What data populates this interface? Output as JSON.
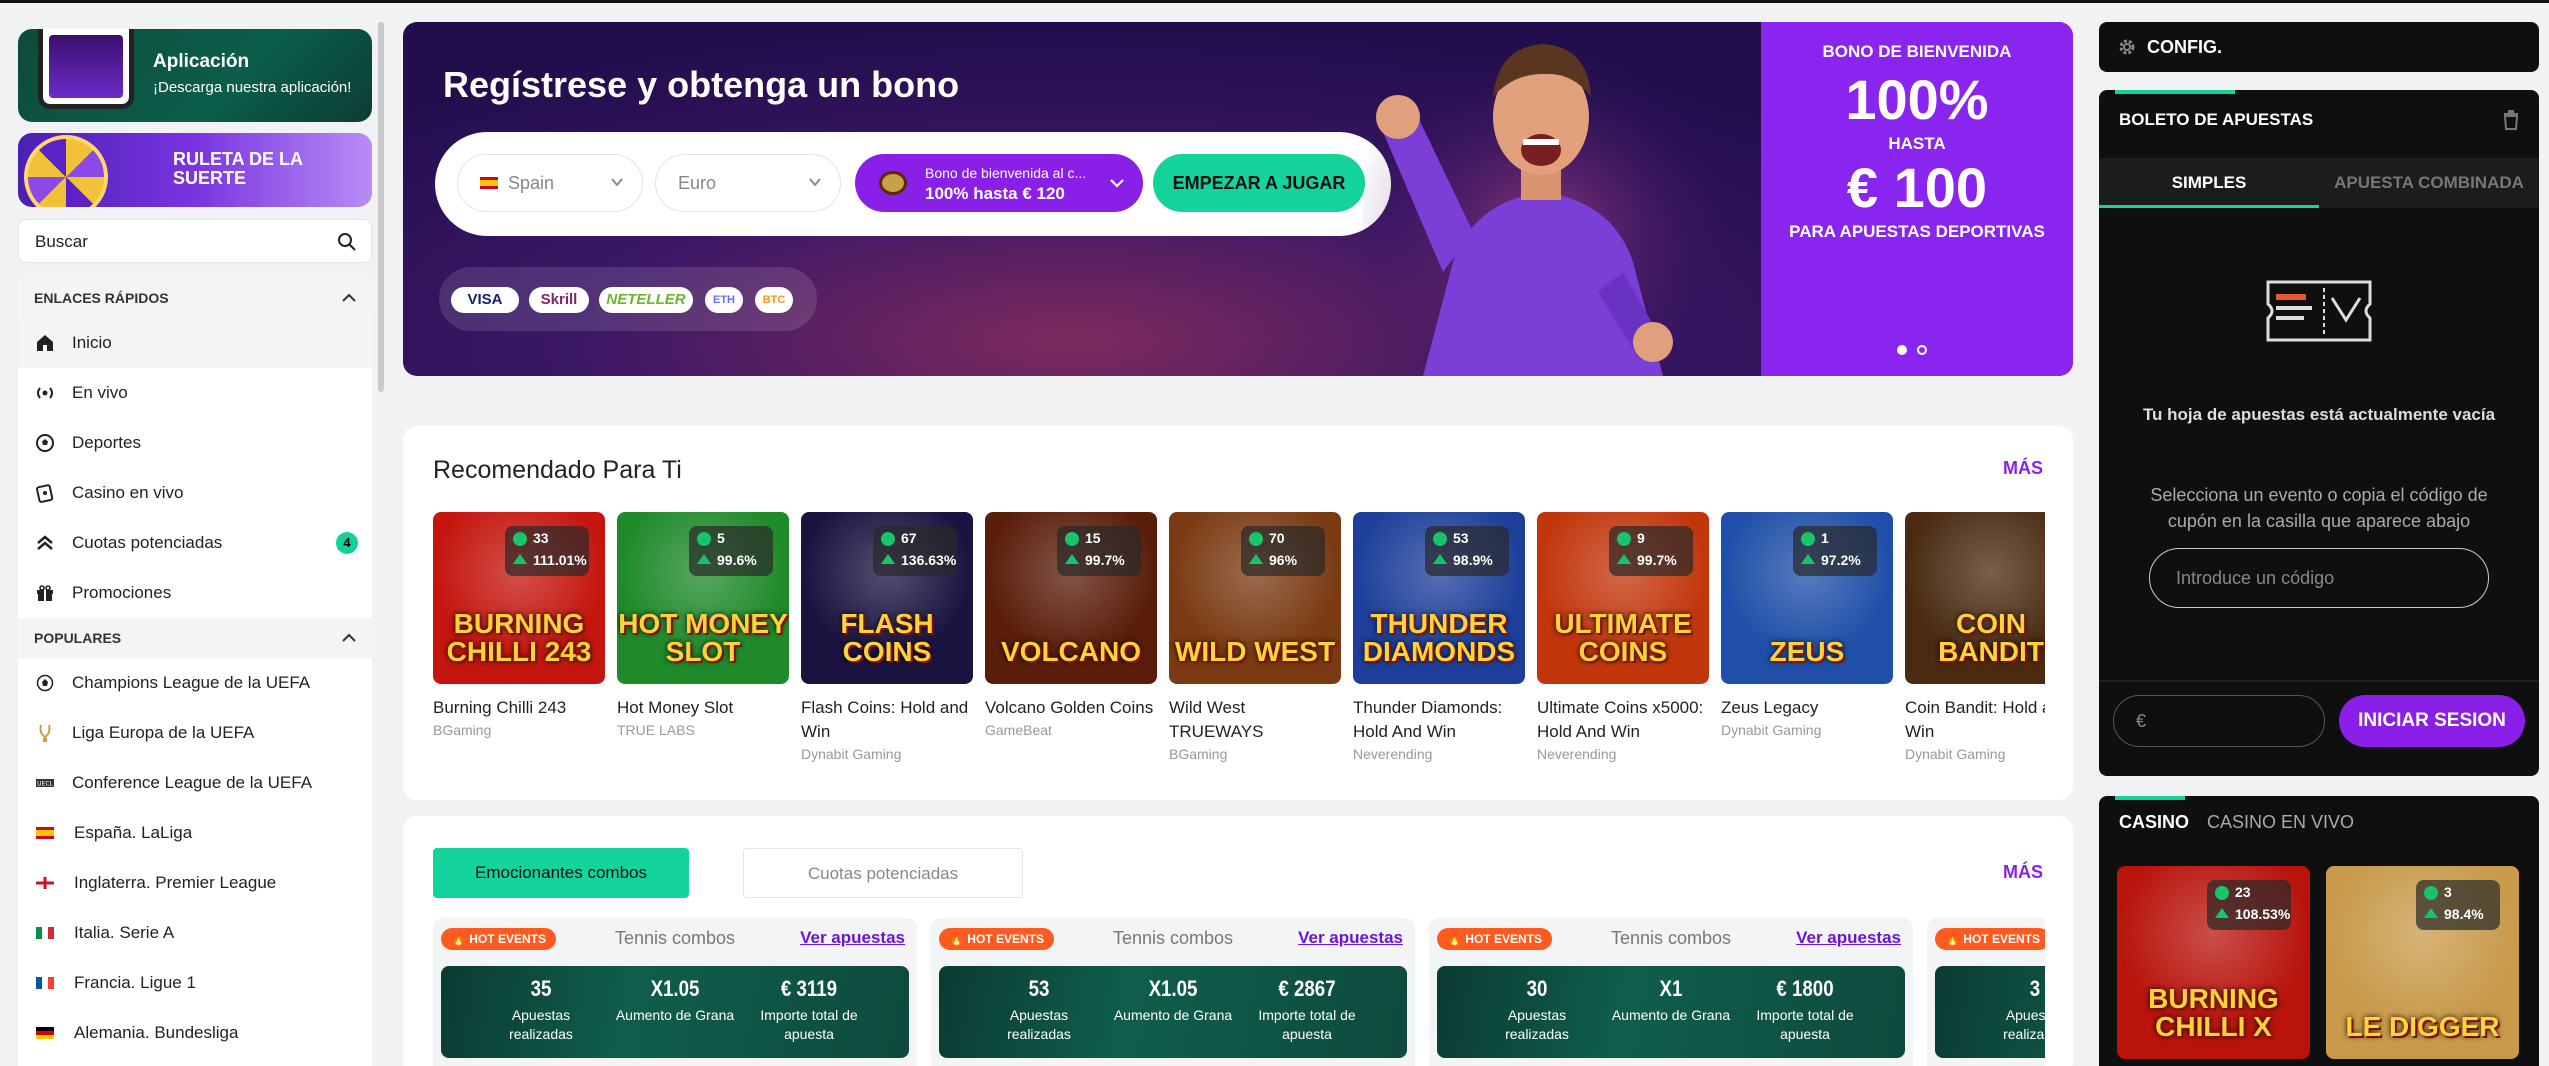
{
  "sidebar": {
    "app_promo": {
      "title": "Aplicación",
      "subtitle": "¡Descarga nuestra aplicación!"
    },
    "wheel_banner": {
      "title": "RULETA DE LA SUERTE"
    },
    "search": {
      "placeholder": "Buscar"
    },
    "quick_links_header": "ENLACES RÁPIDOS",
    "quick_links": [
      {
        "label": "Inicio",
        "icon": "home-icon"
      },
      {
        "label": "En vivo",
        "icon": "live-icon"
      },
      {
        "label": "Deportes",
        "icon": "soccer-ball-icon"
      },
      {
        "label": "Casino en vivo",
        "icon": "live-casino-icon"
      },
      {
        "label": "Cuotas potenciadas",
        "icon": "boost-icon",
        "badge": "4"
      },
      {
        "label": "Promociones",
        "icon": "gift-icon"
      }
    ],
    "popular_header": "POPULARES",
    "popular": [
      {
        "label": "Champions League de la UEFA",
        "icon": "champions-ball-icon"
      },
      {
        "label": "Liga Europa de la UEFA",
        "icon": "europa-trophy-icon"
      },
      {
        "label": "Conference League de la UEFA",
        "icon": "conference-icon"
      },
      {
        "label": "España. LaLiga",
        "icon": "spain-flag-icon"
      },
      {
        "label": "Inglaterra. Premier League",
        "icon": "england-flag-icon"
      },
      {
        "label": "Italia. Serie A",
        "icon": "italy-flag-icon"
      },
      {
        "label": "Francia. Ligue 1",
        "icon": "france-flag-icon"
      },
      {
        "label": "Alemania. Bundesliga",
        "icon": "germany-flag-icon"
      }
    ]
  },
  "hero": {
    "title": "Regístrese y obtenga un bono",
    "country": "Spain",
    "currency": "Euro",
    "bonus_line1": "Bono de bienvenida al c...",
    "bonus_line2": "100% hasta € 120",
    "start_button": "EMPEZAR A JUGAR",
    "payments": [
      "VISA",
      "Skrill",
      "NETELLER",
      "ETH",
      "BTC"
    ],
    "right": {
      "line1": "BONO DE BIENVENIDA",
      "line2": "100%",
      "line3": "HASTA",
      "line4": "€ 100",
      "line5": "PARA APUESTAS DEPORTIVAS"
    }
  },
  "recommended": {
    "title": "Recomendado Para Ti",
    "more": "MÁS",
    "games": [
      {
        "name": "Burning Chilli 243",
        "provider": "BGaming",
        "players": "33",
        "rtp": "111.01%",
        "art": "BURNING CHILLI 243",
        "bg": "#c4160e"
      },
      {
        "name": "Hot Money Slot",
        "provider": "TRUE LABS",
        "players": "5",
        "rtp": "99.6%",
        "art": "HOT MONEY SLOT",
        "bg": "#1f8a2a"
      },
      {
        "name": "Flash Coins: Hold and Win",
        "provider": "Dynabit Gaming",
        "players": "67",
        "rtp": "136.63%",
        "art": "FLASH COINS",
        "bg": "#1a1340"
      },
      {
        "name": "Volcano Golden Coins",
        "provider": "GameBeat",
        "players": "15",
        "rtp": "99.7%",
        "art": "VOLCANO",
        "bg": "#5a1d0a"
      },
      {
        "name": "Wild West TRUEWAYS",
        "provider": "BGaming",
        "players": "70",
        "rtp": "96%",
        "art": "WILD WEST",
        "bg": "#7a3a12"
      },
      {
        "name": "Thunder Diamonds: Hold And Win",
        "provider": "Neverending",
        "players": "53",
        "rtp": "98.9%",
        "art": "THUNDER DIAMONDS",
        "bg": "#1d3f9a"
      },
      {
        "name": "Ultimate Coins x5000: Hold And Win",
        "provider": "Neverending",
        "players": "9",
        "rtp": "99.7%",
        "art": "ULTIMATE COINS",
        "bg": "#c2360c"
      },
      {
        "name": "Zeus Legacy",
        "provider": "Dynabit Gaming",
        "players": "1",
        "rtp": "97.2%",
        "art": "ZEUS",
        "bg": "#1f4fa8"
      },
      {
        "name": "Coin Bandit: Hold and Win",
        "provider": "Dynabit Gaming",
        "players": "",
        "rtp": "",
        "art": "COIN BANDIT",
        "bg": "#4a2b12"
      }
    ]
  },
  "combos": {
    "tab_active": "Emocionantes combos",
    "tab_inactive": "Cuotas potenciadas",
    "more": "MÁS",
    "items": [
      {
        "badge": "HOT EVENTS",
        "type": "Tennis combos",
        "link": "Ver apuestas",
        "bets": "35",
        "bets_label": "Apuestas realizadas",
        "odds": "X1.05",
        "odds_label": "Aumento de Grana",
        "total": "€ 3119",
        "total_label": "Importe total de apuesta"
      },
      {
        "badge": "HOT EVENTS",
        "type": "Tennis combos",
        "link": "Ver apuestas",
        "bets": "53",
        "bets_label": "Apuestas realizadas",
        "odds": "X1.05",
        "odds_label": "Aumento de Grana",
        "total": "€ 2867",
        "total_label": "Importe total de apuesta"
      },
      {
        "badge": "HOT EVENTS",
        "type": "Tennis combos",
        "link": "Ver apuestas",
        "bets": "30",
        "bets_label": "Apuestas realizadas",
        "odds": "X1",
        "odds_label": "Aumento de Grana",
        "total": "€ 1800",
        "total_label": "Importe total de apuesta"
      },
      {
        "badge": "HOT EVENTS",
        "type": "",
        "link": "",
        "bets": "3",
        "bets_label": "Apuestas realizadas",
        "odds": "",
        "odds_label": "",
        "total": "",
        "total_label": ""
      }
    ]
  },
  "right": {
    "config": "CONFIG.",
    "betslip_title": "BOLETO DE APUESTAS",
    "tab_simple": "SIMPLES",
    "tab_combo": "APUESTA COMBINADA",
    "empty_text": "Tu hoja de apuestas está actualmente vacía",
    "hint": "Selecciona un evento o copia el código de cupón en la casilla que aparece abajo",
    "code_placeholder": "Introduce un código",
    "stake_placeholder": "€",
    "login_button": "INICIAR SESION",
    "casino_tab": "CASINO",
    "live_casino_tab": "CASINO EN VIVO",
    "casino_games": [
      {
        "players": "23",
        "rtp": "108.53%",
        "art": "BURNING CHILLI X",
        "bg": "#b8140c"
      },
      {
        "players": "3",
        "rtp": "98.4%",
        "art": "LE DIGGER",
        "bg": "#c89a4a"
      }
    ]
  },
  "colors": {
    "accent_green": "#14d39b",
    "accent_purple": "#8a1fe8",
    "hot": "#ff5a1f"
  }
}
